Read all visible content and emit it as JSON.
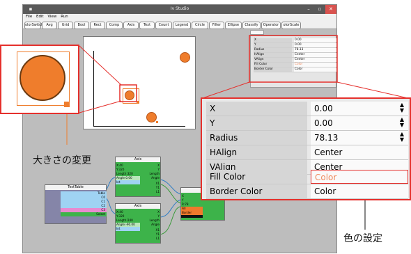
{
  "window": {
    "title": "Iv Studio",
    "minimize": "–",
    "maximize": "▫",
    "close": "✕"
  },
  "menu": [
    "File",
    "Edit",
    "View",
    "Run"
  ],
  "toolbar": [
    "olorSwitch",
    "Avg",
    "Grid",
    "Bool",
    "Rect",
    "Comp",
    "Axis",
    "Text",
    "Count",
    "Legend",
    "Circle",
    "Filter",
    "Ellipse",
    "Classify",
    "Operator",
    "olorScale"
  ],
  "properties": [
    {
      "key": "X",
      "value": "0.00"
    },
    {
      "key": "Y",
      "value": "0.00"
    },
    {
      "key": "Radius",
      "value": "78.13"
    },
    {
      "key": "HAlign",
      "value": "Center"
    },
    {
      "key": "VAlign",
      "value": "Center"
    },
    {
      "key": "Fill Color",
      "value": "Color"
    },
    {
      "key": "Border Color",
      "value": "Color"
    }
  ],
  "nodes": {
    "table": {
      "title": "TestTable",
      "ports": [
        "Table",
        "C0",
        "C1",
        "C2",
        "C3",
        "Select"
      ]
    },
    "axis1": {
      "title": "Axis",
      "ports": [
        "X:40",
        "Y:320",
        "Length:320",
        "Angle:0.00",
        "Int"
      ],
      "outputs": [
        "X",
        "Y",
        "Length",
        "Angle",
        "X1",
        "Y1",
        "L1"
      ]
    },
    "axis2": {
      "title": "Axis",
      "ports": [
        "X:40",
        "Y:320",
        "Length:240",
        "Angle:-90.00",
        "Int"
      ],
      "outputs": [
        "X",
        "Y",
        "Length",
        "Angle",
        "X1",
        "Y1",
        "L1"
      ]
    },
    "circle": {
      "title": "",
      "ports": [
        "X",
        "Y",
        "R:78",
        "Fill",
        "Border"
      ]
    }
  },
  "annotations": {
    "size_change": "大きさの変更",
    "color_setting": "色の設定"
  },
  "colors": {
    "accent_orange": "#ef7d2c",
    "callout_red": "#e5302c",
    "node_green": "#3db34a",
    "node_blue": "#9fd3f3",
    "node_pink": "#e88ad0",
    "fill_color_text": "#f08a5d"
  }
}
